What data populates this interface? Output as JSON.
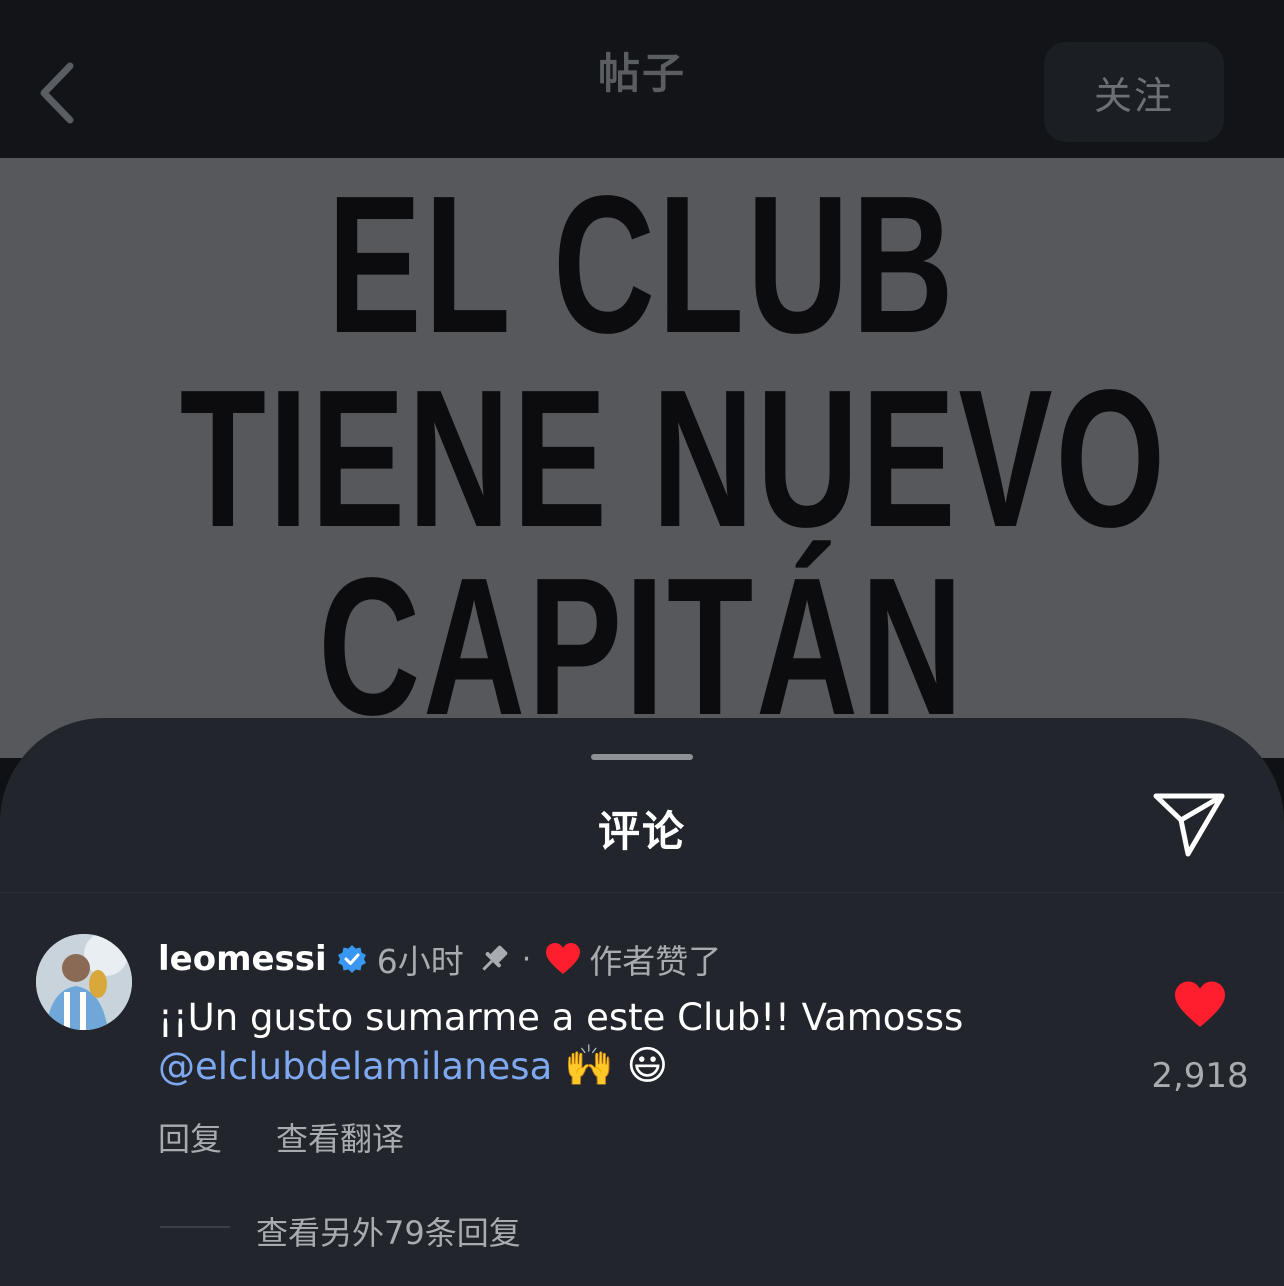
{
  "topbar": {
    "title": "帖子",
    "subtitle": "",
    "follow_label": "关注"
  },
  "post": {
    "lines": [
      "EL CLUB",
      "TIENE NUEVO",
      "CAPITÁN"
    ]
  },
  "comments_sheet": {
    "title": "评论"
  },
  "comment": {
    "username": "leomessi",
    "time": "6小时",
    "separator": "·",
    "author_liked": "作者赞了",
    "text": "¡¡Un gusto sumarme a este Club!! Vamosss",
    "mention": "@elclubdelamilanesa",
    "emojis": "🙌 😃",
    "reply_label": "回复",
    "translate_label": "查看翻译",
    "like_count": "2,918",
    "view_replies": "查看另外79条回复"
  },
  "colors": {
    "background": "#0f1114",
    "sheet": "#22252b",
    "like_red": "#ff1e2d",
    "verified_blue": "#3897f0",
    "mention_blue": "#7ea8f0"
  },
  "icons": {
    "back": "chevron-left-icon",
    "share": "paper-plane-icon",
    "verified": "verified-badge-icon",
    "pin": "pin-icon",
    "like": "heart-icon"
  }
}
